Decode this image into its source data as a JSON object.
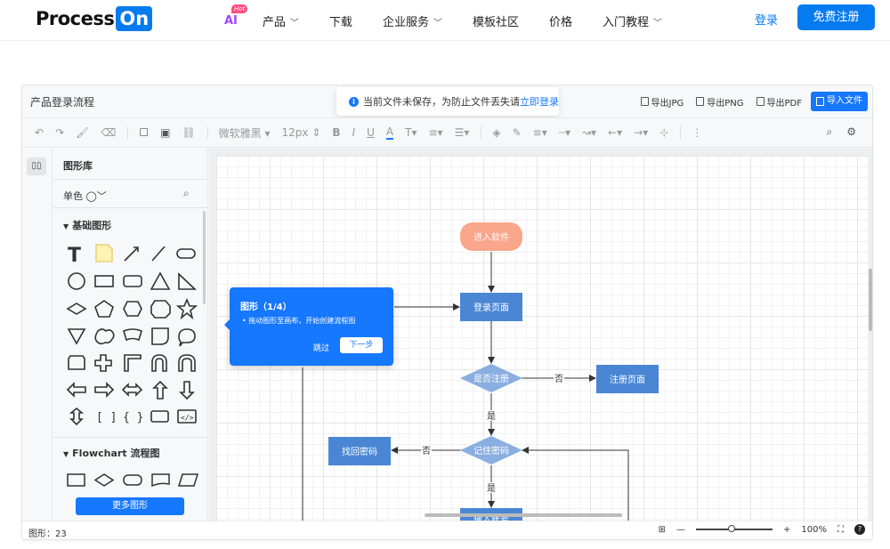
{
  "brand": {
    "name_a": "Process",
    "name_b": "On"
  },
  "nav": {
    "ai": "AI",
    "hot": "Hot",
    "items": [
      "产品",
      "下载",
      "企业服务",
      "模板社区",
      "价格",
      "入门教程"
    ],
    "login": "登录",
    "register": "免费注册"
  },
  "editor": {
    "doc_title": "产品登录流程",
    "notice": {
      "text": "当前文件未保存，为防止文件丢失请",
      "link": "立即登录"
    },
    "exports": [
      "导出JPG",
      "导出PNG",
      "导出PDF"
    ],
    "import": "导入文件",
    "toolbar": {
      "font": "微软雅黑",
      "size": "12px"
    }
  },
  "library": {
    "title": "图形库",
    "fill_mode": "单色",
    "section_basic": "基础图形",
    "section_flowchart": "Flowchart 流程图",
    "more": "更多图形"
  },
  "flowchart": {
    "start": "进入软件",
    "login_page": "登录页面",
    "is_registered": "是否注册",
    "register_page": "注册页面",
    "remember_pwd": "记住密码",
    "recover_pwd": "找回密码",
    "enter_account": "输入账号",
    "yes": "是",
    "no": "否"
  },
  "tour": {
    "title": "图形（1/4）",
    "desc": "拖动图形至画布，开始创建流程图",
    "skip": "跳过",
    "next": "下一步"
  },
  "status": {
    "shape_count": "图形：23",
    "zoom": "100%"
  },
  "colors": {
    "accent": "#1677ff",
    "node_blue": "#4a86d4",
    "node_start": "#f9a68b",
    "diamond": "#8aaee0"
  }
}
